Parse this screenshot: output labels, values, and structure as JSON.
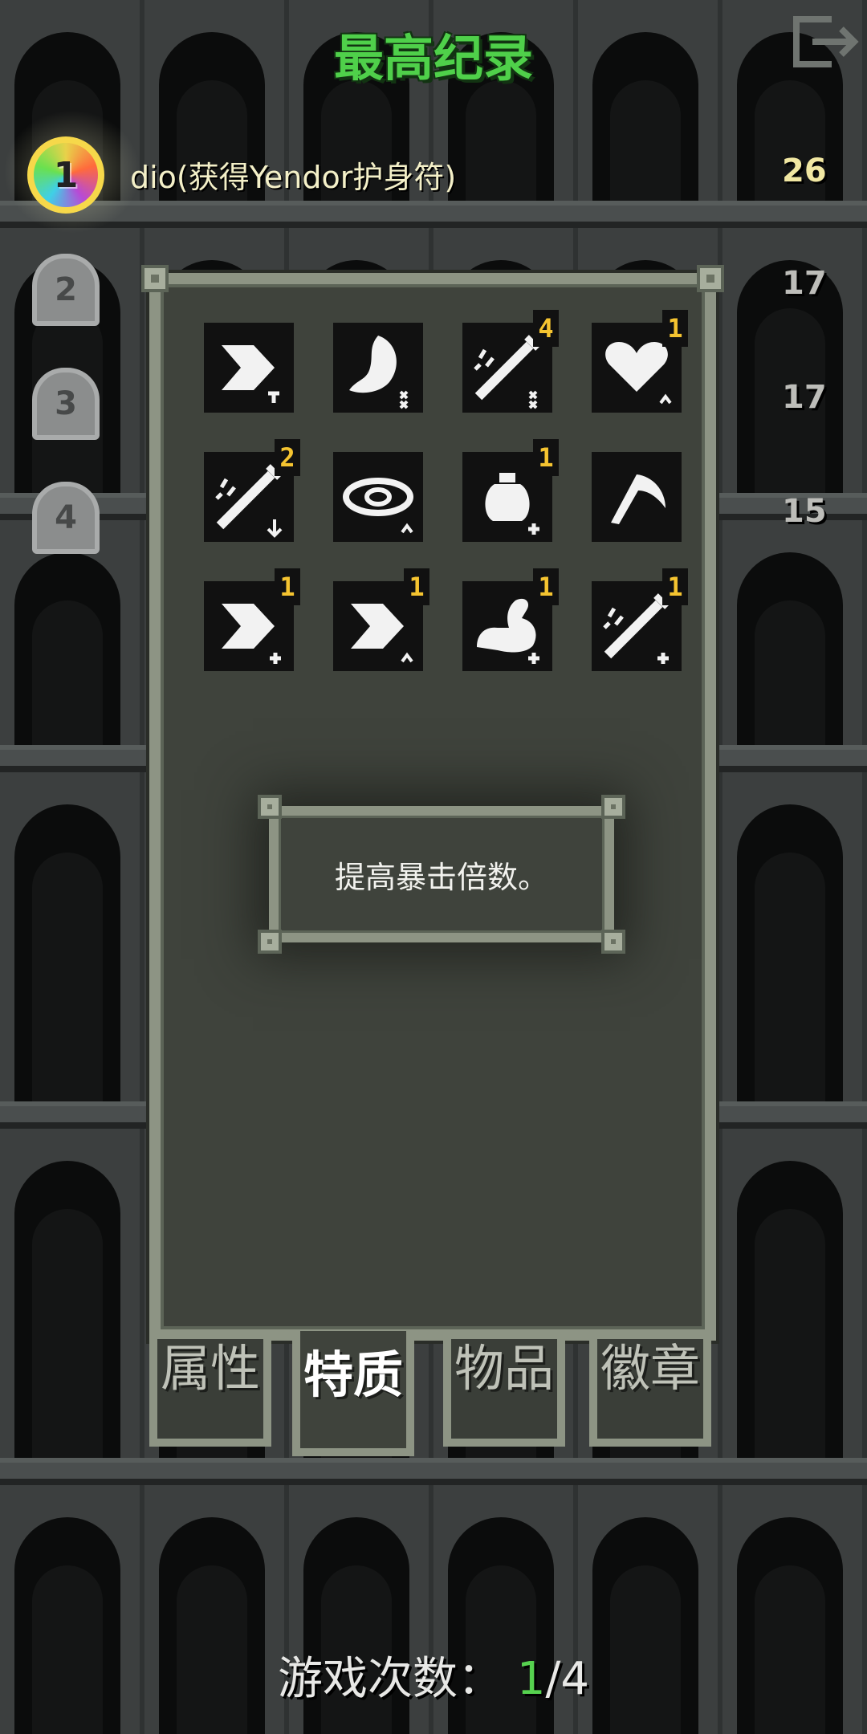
{
  "header": {
    "title": "最高纪录",
    "exit_icon": "exit-door-icon"
  },
  "records": [
    {
      "rank": "1",
      "text": "dio(获得Yendor护身符)",
      "depth": "26",
      "icon": "yendor-amulet-icon"
    },
    {
      "rank": "2",
      "text": "...",
      "depth": "17",
      "icon": "tombstone-icon"
    },
    {
      "rank": "3",
      "text": "...",
      "depth": "17",
      "icon": "tombstone-icon"
    },
    {
      "rank": "4",
      "text": "...",
      "depth": "15",
      "icon": "tombstone-icon"
    }
  ],
  "traits": [
    {
      "icon": "dash-arrow-icon",
      "count": ""
    },
    {
      "icon": "stomach-icon",
      "count": ""
    },
    {
      "icon": "sword-strike-icon",
      "count": "4"
    },
    {
      "icon": "heart-icon",
      "count": "1"
    },
    {
      "icon": "sword-strike-icon",
      "count": "2"
    },
    {
      "icon": "eye-icon",
      "count": ""
    },
    {
      "icon": "potion-icon",
      "count": "1"
    },
    {
      "icon": "sickle-icon",
      "count": ""
    },
    {
      "icon": "dash-arrow-icon",
      "count": "1"
    },
    {
      "icon": "dash-arrow-icon",
      "count": "1"
    },
    {
      "icon": "strength-arm-icon",
      "count": "1"
    },
    {
      "icon": "sword-strike-icon",
      "count": "1"
    }
  ],
  "tooltip": {
    "text": "提高暴击倍数。"
  },
  "tabs": [
    {
      "label": "属性",
      "active": false
    },
    {
      "label": "特质",
      "active": true
    },
    {
      "label": "物品",
      "active": false
    },
    {
      "label": "徽章",
      "active": false
    }
  ],
  "footer": {
    "label": "游戏次数：",
    "current": "1",
    "separator": "/",
    "total": "4"
  },
  "colors": {
    "title_green": "#4fd04a",
    "badge_yellow": "#f5c430",
    "panel": "#3f433c",
    "frame": "#8d9484"
  }
}
